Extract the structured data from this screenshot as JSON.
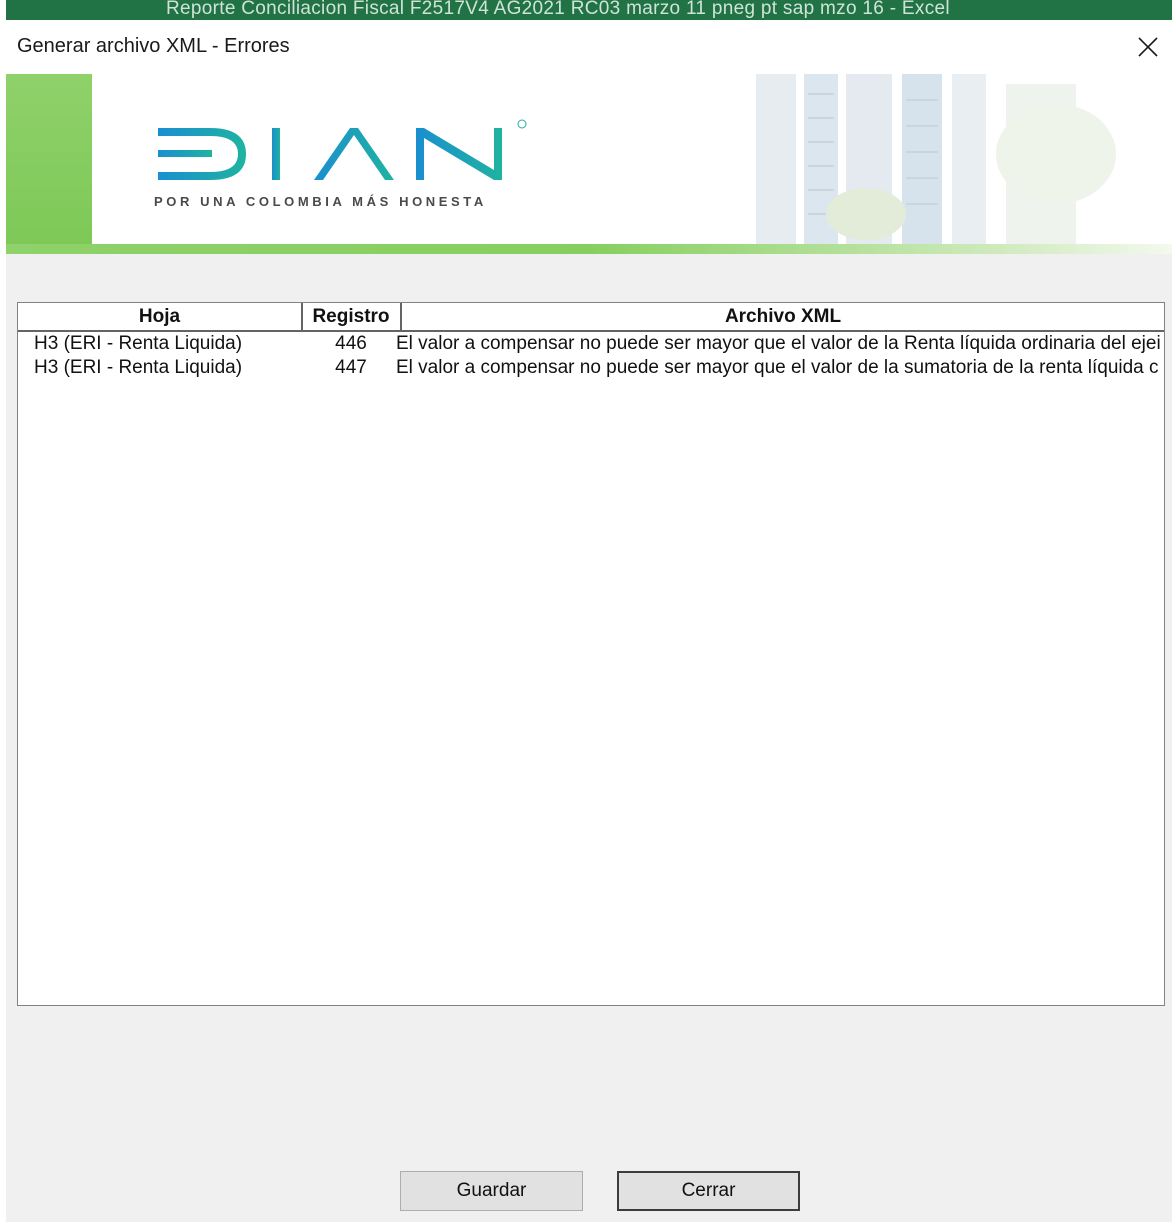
{
  "background_window": {
    "title": "Reporte Conciliacion Fiscal F2517V4 AG2021 RC03 marzo 11 pneg pt sap mzo 16 - Excel"
  },
  "dialog": {
    "title": "Generar archivo XML - Errores",
    "close_icon": "close-icon"
  },
  "banner": {
    "logo_text": "DIAN",
    "tagline": "POR UNA COLOMBIA MÁS HONESTA",
    "brand_colors": {
      "green": "#8fd16a",
      "logo_blue": "#1a9bc8",
      "logo_teal": "#1fb3a0"
    }
  },
  "table": {
    "columns": [
      "Hoja",
      "Registro",
      "Archivo XML"
    ],
    "rows": [
      {
        "hoja": "H3 (ERI - Renta Liquida)",
        "registro": "446",
        "archivo_xml": "El valor a compensar no puede ser mayor que el valor de la Renta líquida ordinaria del ejei"
      },
      {
        "hoja": "H3 (ERI - Renta Liquida)",
        "registro": "447",
        "archivo_xml": "El valor a compensar no puede ser mayor que el valor de la sumatoria de la renta líquida c"
      }
    ]
  },
  "buttons": {
    "save": "Guardar",
    "close": "Cerrar"
  }
}
